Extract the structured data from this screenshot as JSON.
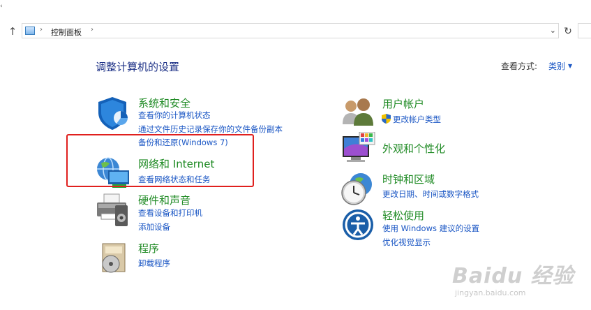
{
  "addressbar": {
    "breadcrumb": "控制面板",
    "separator": "›"
  },
  "page": {
    "heading": "调整计算机的设置",
    "view_by_label": "查看方式:",
    "view_by_value": "类别"
  },
  "categories_left": [
    {
      "icon": "shield-icon",
      "title": "系统和安全",
      "links": [
        "查看你的计算机状态",
        "通过文件历史记录保存你的文件备份副本",
        "备份和还原(Windows 7)"
      ]
    },
    {
      "icon": "network-globe-icon",
      "title": "网络和 Internet",
      "links": [
        "查看网络状态和任务"
      ]
    },
    {
      "icon": "printer-icon",
      "title": "硬件和声音",
      "links": [
        "查看设备和打印机",
        "添加设备"
      ]
    },
    {
      "icon": "program-disc-icon",
      "title": "程序",
      "links": [
        "卸载程序"
      ]
    }
  ],
  "categories_right": [
    {
      "icon": "users-icon",
      "title": "用户帐户",
      "links": [
        "更改帐户类型"
      ]
    },
    {
      "icon": "monitor-palette-icon",
      "title": "外观和个性化",
      "links": []
    },
    {
      "icon": "clock-globe-icon",
      "title": "时钟和区域",
      "links": [
        "更改日期、时间或数字格式"
      ]
    },
    {
      "icon": "ease-of-access-icon",
      "title": "轻松使用",
      "links": [
        "使用 Windows 建议的设置",
        "优化视觉显示"
      ]
    }
  ],
  "watermark": {
    "brand": "Baidu 经验",
    "url": "jingyan.baidu.com"
  },
  "colors": {
    "title_green": "#1e8a23",
    "link_blue": "#1a56c4",
    "heading_blue": "#1e3287",
    "highlight_red": "#e0201e"
  }
}
